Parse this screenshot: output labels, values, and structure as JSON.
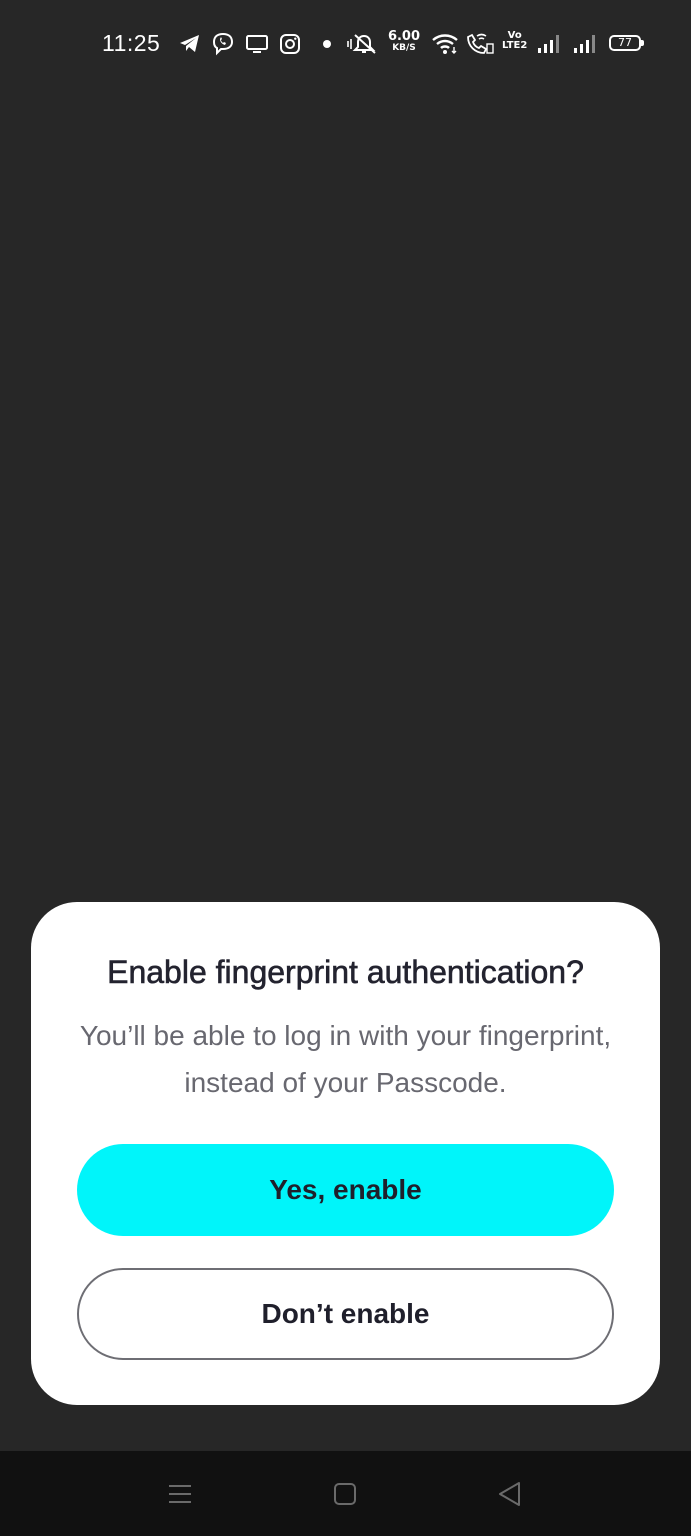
{
  "status_bar": {
    "time": "11:25",
    "net_speed_value": "6.00",
    "net_speed_unit": "KB/S",
    "volte_top": "Vo",
    "volte_bottom": "LTE2",
    "battery_level": "77",
    "icons": [
      "telegram-icon",
      "viber-icon",
      "screen-cast-icon",
      "instagram-icon",
      "dot-icon",
      "mute-icon",
      "wifi-icon",
      "wifi-calling-icon",
      "signal-icon",
      "signal-icon"
    ]
  },
  "dialog": {
    "title": "Enable fingerprint authentication?",
    "message": "You’ll be able to log in with your fingerprint, instead of your Passcode.",
    "primary_button": "Yes, enable",
    "secondary_button": "Don’t enable"
  },
  "nav_bar": {
    "icons": [
      "menu-icon",
      "home-icon",
      "back-icon"
    ]
  },
  "colors": {
    "background": "#272727",
    "dialog_background": "#ffffff",
    "primary_button": "#00f5fa",
    "title_text": "#23232f",
    "message_text": "#686870",
    "nav_bar": "#111111"
  }
}
